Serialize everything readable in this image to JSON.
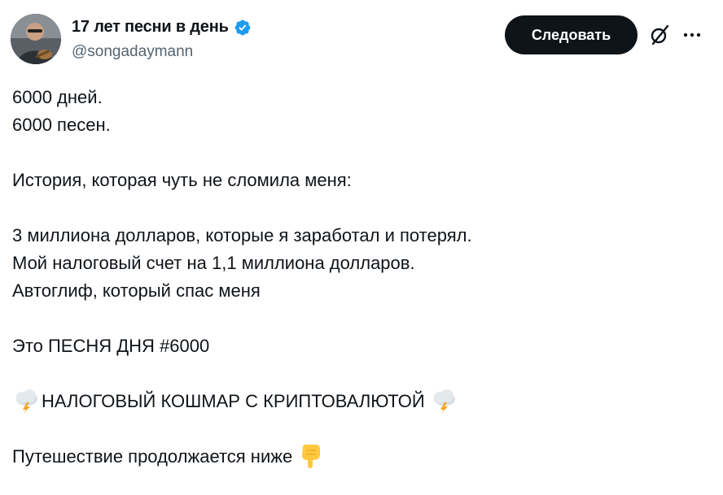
{
  "author": {
    "display_name": "17 лет песни в день",
    "handle": "@songadaymann",
    "verified_icon": "verified-badge-icon"
  },
  "actions": {
    "follow_label": "Следовать",
    "grok_icon": "grok-icon",
    "more_icon": "more-options-icon"
  },
  "tweet": {
    "lines": [
      "6000 дней.",
      "6000 песен.",
      "",
      "История, которая чуть не сломила меня:",
      "",
      "3 миллиона долларов, которые я заработал и потерял.",
      "Мой налоговый счет на 1,1 миллиона долларов.",
      "Автоглиф, который спас меня",
      "",
      "Это ПЕСНЯ ДНЯ #6000",
      "",
      "НАЛОГОВЫЙ КОШМАР С КРИПТОВАЛЮТОЙ",
      "",
      "Путешествие продолжается ниже"
    ],
    "storm_emoji": "cloud-lightning-emoji",
    "pointing_emoji": "pointing-down-emoji"
  },
  "colors": {
    "text": "#0f1419",
    "secondary": "#536471",
    "verified": "#1d9bf0",
    "button_bg": "#0f1419"
  }
}
